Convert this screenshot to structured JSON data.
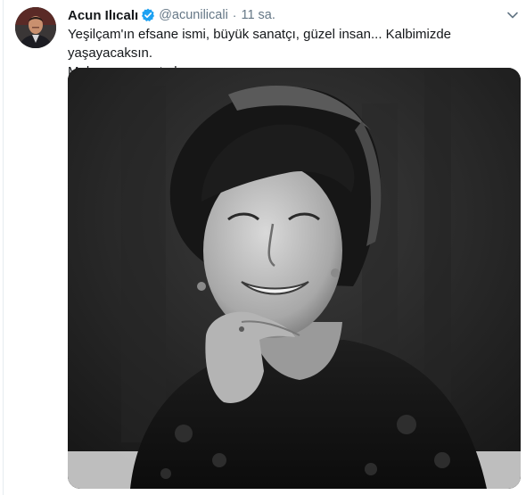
{
  "tweet": {
    "author_name": "Acun Ilıcalı",
    "handle": "@acunilicali",
    "separator": "·",
    "time": "11 sa.",
    "text_line1": "Yeşilçam'ın efsane ismi, büyük sanatçı, güzel insan... Kalbimizde yaşayacaksın.",
    "text_line2": "Mekanın cennet olsun."
  },
  "icons": {
    "verified": "verified-badge-icon",
    "caret": "chevron-down-icon"
  },
  "colors": {
    "verified_blue": "#1da1f2",
    "secondary_text": "#657786",
    "primary_text": "#14171a"
  }
}
